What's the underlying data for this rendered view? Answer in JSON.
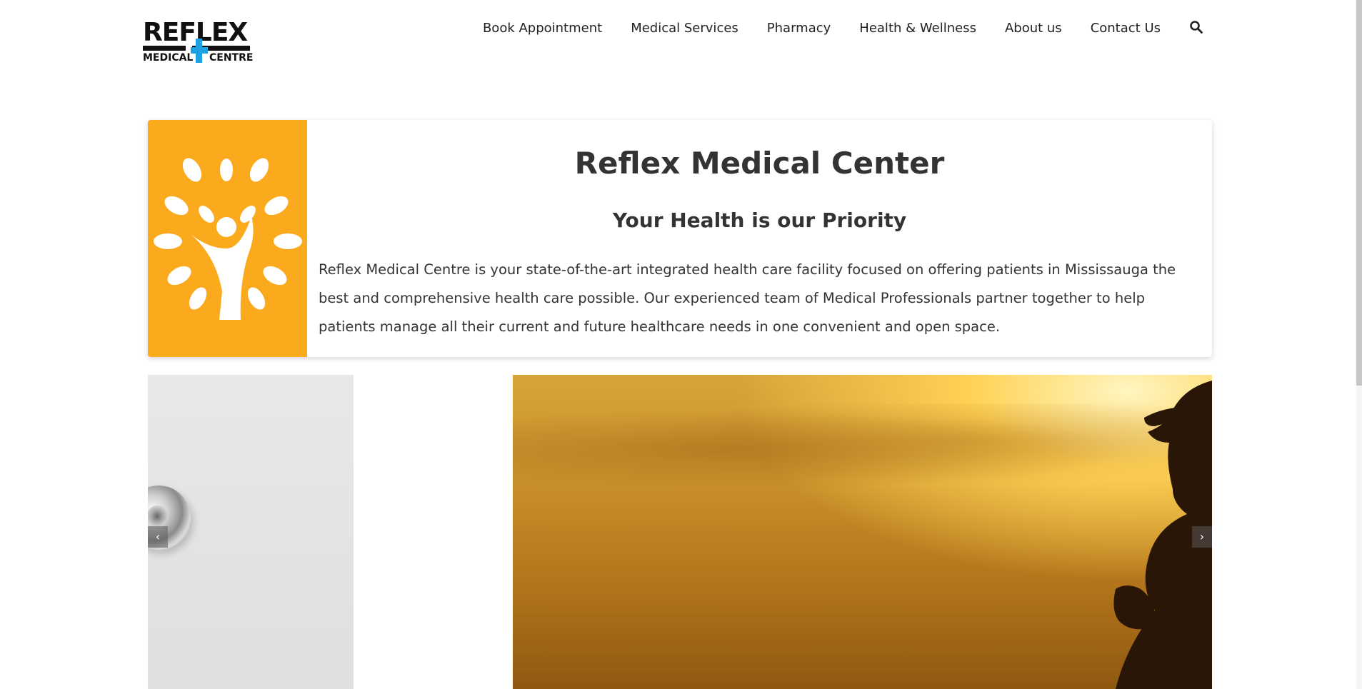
{
  "logo": {
    "top_text": "REFLEX",
    "bottom_left": "MEDICAL",
    "bottom_right": "CENTRE",
    "accent_color": "#1da1e2"
  },
  "nav": {
    "items": [
      {
        "label": "Book Appointment"
      },
      {
        "label": "Medical Services"
      },
      {
        "label": "Pharmacy"
      },
      {
        "label": "Health & Wellness"
      },
      {
        "label": "About us"
      },
      {
        "label": "Contact Us"
      }
    ],
    "search_icon": "search-icon"
  },
  "intro": {
    "title": "Reflex Medical Center",
    "subtitle": "Your Health is our Priority",
    "body": "Reflex Medical Centre is your state-of-the-art integrated health care facility focused on offering patients in Mississauga the best and comprehensive health care possible. Our experienced team of Medical Professionals partner together to help patients manage all their current and future healthcare needs in one convenient and open space.",
    "icon": "wellness-tree-icon",
    "icon_bg": "#fbaa1d"
  },
  "carousel": {
    "prev_label": "‹",
    "next_label": "›"
  }
}
